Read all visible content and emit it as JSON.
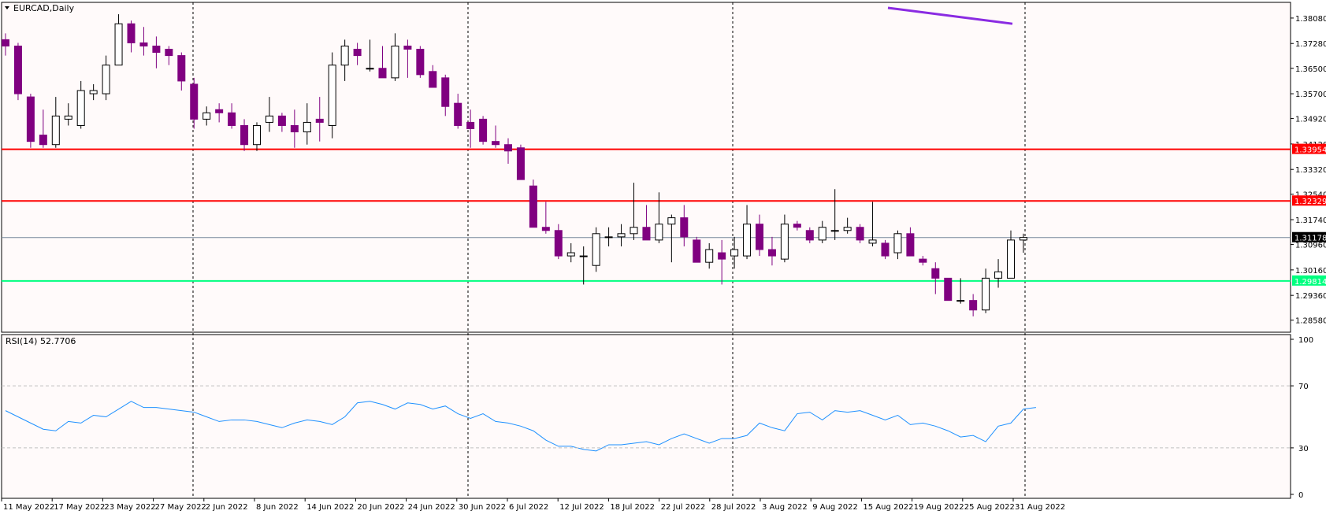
{
  "symbol_label": "EURCAD,Daily",
  "rsi_label": "RSI(14) 52.7706",
  "colors": {
    "background": "#fffafa",
    "bear": "#800080",
    "bull_fill": "#ffffff",
    "candle_outline": "#000000",
    "resistance": "#ff0000",
    "support": "#00ff7f",
    "ma_line": "#8a2be2",
    "rsi_line": "#1e90ff",
    "current_price_line": "#778899",
    "grid_vertical": "#000000"
  },
  "chart_data": [
    {
      "type": "candlestick",
      "title": "EURCAD,Daily",
      "ylim": [
        1.283,
        1.384
      ],
      "y_ticks": [
        "1.38080",
        "1.37280",
        "1.36500",
        "1.35700",
        "1.34920",
        "1.34120",
        "1.33320",
        "1.32540",
        "1.31740",
        "1.30960",
        "1.30160",
        "1.29360",
        "1.28580"
      ],
      "x_ticks": [
        "11 May 2022",
        "17 May 2022",
        "23 May 2022",
        "27 May 2022",
        "2 Jun 2022",
        "8 Jun 2022",
        "14 Jun 2022",
        "20 Jun 2022",
        "24 Jun 2022",
        "30 Jun 2022",
        "6 Jul 2022",
        "12 Jul 2022",
        "18 Jul 2022",
        "22 Jul 2022",
        "28 Jul 2022",
        "3 Aug 2022",
        "9 Aug 2022",
        "15 Aug 2022",
        "19 Aug 2022",
        "25 Aug 2022",
        "31 Aug 2022"
      ],
      "date_separators": [
        "27 May 2022",
        "30 Jun 2022",
        "28 Jul 2022",
        "31 Aug 2022"
      ],
      "candles": [
        {
          "open": 1.374,
          "high": 1.376,
          "low": 1.369,
          "close": 1.372
        },
        {
          "open": 1.372,
          "high": 1.373,
          "low": 1.355,
          "close": 1.357
        },
        {
          "open": 1.356,
          "high": 1.357,
          "low": 1.34,
          "close": 1.342
        },
        {
          "open": 1.344,
          "high": 1.352,
          "low": 1.34,
          "close": 1.341
        },
        {
          "open": 1.341,
          "high": 1.356,
          "low": 1.34,
          "close": 1.35
        },
        {
          "open": 1.349,
          "high": 1.354,
          "low": 1.347,
          "close": 1.35
        },
        {
          "open": 1.347,
          "high": 1.361,
          "low": 1.346,
          "close": 1.358
        },
        {
          "open": 1.357,
          "high": 1.36,
          "low": 1.355,
          "close": 1.358
        },
        {
          "open": 1.357,
          "high": 1.369,
          "low": 1.355,
          "close": 1.366
        },
        {
          "open": 1.366,
          "high": 1.382,
          "low": 1.366,
          "close": 1.379
        },
        {
          "open": 1.379,
          "high": 1.38,
          "low": 1.37,
          "close": 1.373
        },
        {
          "open": 1.373,
          "high": 1.378,
          "low": 1.369,
          "close": 1.372
        },
        {
          "open": 1.372,
          "high": 1.375,
          "low": 1.365,
          "close": 1.37
        },
        {
          "open": 1.371,
          "high": 1.372,
          "low": 1.366,
          "close": 1.369
        },
        {
          "open": 1.369,
          "high": 1.37,
          "low": 1.358,
          "close": 1.361
        },
        {
          "open": 1.36,
          "high": 1.362,
          "low": 1.346,
          "close": 1.349
        },
        {
          "open": 1.349,
          "high": 1.353,
          "low": 1.347,
          "close": 1.351
        },
        {
          "open": 1.352,
          "high": 1.354,
          "low": 1.348,
          "close": 1.351
        },
        {
          "open": 1.351,
          "high": 1.354,
          "low": 1.346,
          "close": 1.347
        },
        {
          "open": 1.347,
          "high": 1.349,
          "low": 1.339,
          "close": 1.341
        },
        {
          "open": 1.341,
          "high": 1.348,
          "low": 1.339,
          "close": 1.347
        },
        {
          "open": 1.348,
          "high": 1.356,
          "low": 1.345,
          "close": 1.35
        },
        {
          "open": 1.35,
          "high": 1.351,
          "low": 1.345,
          "close": 1.347
        },
        {
          "open": 1.347,
          "high": 1.352,
          "low": 1.34,
          "close": 1.345
        },
        {
          "open": 1.345,
          "high": 1.354,
          "low": 1.341,
          "close": 1.348
        },
        {
          "open": 1.349,
          "high": 1.356,
          "low": 1.342,
          "close": 1.348
        },
        {
          "open": 1.347,
          "high": 1.37,
          "low": 1.343,
          "close": 1.366
        },
        {
          "open": 1.366,
          "high": 1.374,
          "low": 1.361,
          "close": 1.372
        },
        {
          "open": 1.371,
          "high": 1.373,
          "low": 1.366,
          "close": 1.369
        },
        {
          "open": 1.365,
          "high": 1.374,
          "low": 1.364,
          "close": 1.365
        },
        {
          "open": 1.365,
          "high": 1.372,
          "low": 1.362,
          "close": 1.362
        },
        {
          "open": 1.362,
          "high": 1.376,
          "low": 1.361,
          "close": 1.372
        },
        {
          "open": 1.372,
          "high": 1.374,
          "low": 1.362,
          "close": 1.371
        },
        {
          "open": 1.371,
          "high": 1.372,
          "low": 1.362,
          "close": 1.363
        },
        {
          "open": 1.364,
          "high": 1.366,
          "low": 1.359,
          "close": 1.359
        },
        {
          "open": 1.362,
          "high": 1.363,
          "low": 1.35,
          "close": 1.353
        },
        {
          "open": 1.354,
          "high": 1.357,
          "low": 1.346,
          "close": 1.347
        },
        {
          "open": 1.348,
          "high": 1.352,
          "low": 1.34,
          "close": 1.346
        },
        {
          "open": 1.349,
          "high": 1.35,
          "low": 1.341,
          "close": 1.342
        },
        {
          "open": 1.342,
          "high": 1.347,
          "low": 1.34,
          "close": 1.341
        },
        {
          "open": 1.341,
          "high": 1.343,
          "low": 1.335,
          "close": 1.339
        },
        {
          "open": 1.34,
          "high": 1.341,
          "low": 1.33,
          "close": 1.33
        },
        {
          "open": 1.328,
          "high": 1.33,
          "low": 1.315,
          "close": 1.315
        },
        {
          "open": 1.315,
          "high": 1.323,
          "low": 1.313,
          "close": 1.314
        },
        {
          "open": 1.314,
          "high": 1.316,
          "low": 1.305,
          "close": 1.306
        },
        {
          "open": 1.306,
          "high": 1.31,
          "low": 1.304,
          "close": 1.307
        },
        {
          "open": 1.306,
          "high": 1.309,
          "low": 1.297,
          "close": 1.306
        },
        {
          "open": 1.303,
          "high": 1.315,
          "low": 1.301,
          "close": 1.313
        },
        {
          "open": 1.312,
          "high": 1.315,
          "low": 1.309,
          "close": 1.312
        },
        {
          "open": 1.312,
          "high": 1.316,
          "low": 1.309,
          "close": 1.313
        },
        {
          "open": 1.313,
          "high": 1.329,
          "low": 1.311,
          "close": 1.315
        },
        {
          "open": 1.315,
          "high": 1.322,
          "low": 1.312,
          "close": 1.311
        },
        {
          "open": 1.311,
          "high": 1.326,
          "low": 1.31,
          "close": 1.316
        },
        {
          "open": 1.316,
          "high": 1.319,
          "low": 1.304,
          "close": 1.318
        },
        {
          "open": 1.318,
          "high": 1.322,
          "low": 1.309,
          "close": 1.312
        },
        {
          "open": 1.311,
          "high": 1.312,
          "low": 1.304,
          "close": 1.304
        },
        {
          "open": 1.304,
          "high": 1.31,
          "low": 1.302,
          "close": 1.308
        },
        {
          "open": 1.307,
          "high": 1.311,
          "low": 1.297,
          "close": 1.305
        },
        {
          "open": 1.306,
          "high": 1.312,
          "low": 1.302,
          "close": 1.308
        },
        {
          "open": 1.306,
          "high": 1.322,
          "low": 1.305,
          "close": 1.316
        },
        {
          "open": 1.316,
          "high": 1.319,
          "low": 1.306,
          "close": 1.308
        },
        {
          "open": 1.308,
          "high": 1.312,
          "low": 1.303,
          "close": 1.306
        },
        {
          "open": 1.305,
          "high": 1.319,
          "low": 1.304,
          "close": 1.316
        },
        {
          "open": 1.316,
          "high": 1.317,
          "low": 1.314,
          "close": 1.315
        },
        {
          "open": 1.314,
          "high": 1.315,
          "low": 1.31,
          "close": 1.311
        },
        {
          "open": 1.311,
          "high": 1.317,
          "low": 1.31,
          "close": 1.315
        },
        {
          "open": 1.314,
          "high": 1.327,
          "low": 1.311,
          "close": 1.314
        },
        {
          "open": 1.314,
          "high": 1.318,
          "low": 1.313,
          "close": 1.315
        },
        {
          "open": 1.315,
          "high": 1.316,
          "low": 1.31,
          "close": 1.311
        },
        {
          "open": 1.31,
          "high": 1.323,
          "low": 1.309,
          "close": 1.311
        },
        {
          "open": 1.31,
          "high": 1.311,
          "low": 1.305,
          "close": 1.306
        },
        {
          "open": 1.307,
          "high": 1.314,
          "low": 1.305,
          "close": 1.313
        },
        {
          "open": 1.313,
          "high": 1.315,
          "low": 1.306,
          "close": 1.306
        },
        {
          "open": 1.305,
          "high": 1.306,
          "low": 1.303,
          "close": 1.304
        },
        {
          "open": 1.302,
          "high": 1.304,
          "low": 1.294,
          "close": 1.299
        },
        {
          "open": 1.299,
          "high": 1.299,
          "low": 1.292,
          "close": 1.292
        },
        {
          "open": 1.292,
          "high": 1.299,
          "low": 1.291,
          "close": 1.292
        },
        {
          "open": 1.292,
          "high": 1.294,
          "low": 1.287,
          "close": 1.289
        },
        {
          "open": 1.289,
          "high": 1.302,
          "low": 1.288,
          "close": 1.299
        },
        {
          "open": 1.299,
          "high": 1.305,
          "low": 1.296,
          "close": 1.301
        },
        {
          "open": 1.299,
          "high": 1.314,
          "low": 1.299,
          "close": 1.311
        },
        {
          "open": 1.311,
          "high": 1.313,
          "low": 1.307,
          "close": 1.3118
        }
      ],
      "moving_average": {
        "segment_start": 1.384,
        "segment_end": 1.379
      },
      "horizontal_levels": [
        {
          "value": 1.33954,
          "label": "1.33954",
          "kind": "resistance"
        },
        {
          "value": 1.32329,
          "label": "1.32329",
          "kind": "resistance"
        },
        {
          "value": 1.31178,
          "label": "1.31178",
          "kind": "current"
        },
        {
          "value": 1.29814,
          "label": "1.29814",
          "kind": "support"
        }
      ]
    },
    {
      "type": "line",
      "title": "RSI(14) 52.7706",
      "ylim": [
        0,
        100
      ],
      "y_ticks": [
        "100",
        "70",
        "30",
        "0"
      ],
      "levels": [
        70,
        30
      ],
      "values": [
        54,
        50,
        46,
        42,
        41,
        47,
        46,
        51,
        50,
        55,
        60,
        56,
        56,
        55,
        54,
        53,
        50,
        47,
        48,
        48,
        47,
        45,
        43,
        46,
        48,
        47,
        45,
        50,
        59,
        60,
        58,
        55,
        59,
        58,
        55,
        57,
        52,
        49,
        52,
        47,
        46,
        44,
        41,
        35,
        31,
        31,
        29,
        28,
        32,
        32,
        33,
        34,
        32,
        36,
        39,
        36,
        33,
        36,
        36,
        38,
        46,
        43,
        41,
        52,
        53,
        48,
        54,
        53,
        54,
        51,
        48,
        51,
        45,
        46,
        44,
        41,
        37,
        38,
        34,
        44,
        46,
        55,
        56
      ]
    }
  ]
}
